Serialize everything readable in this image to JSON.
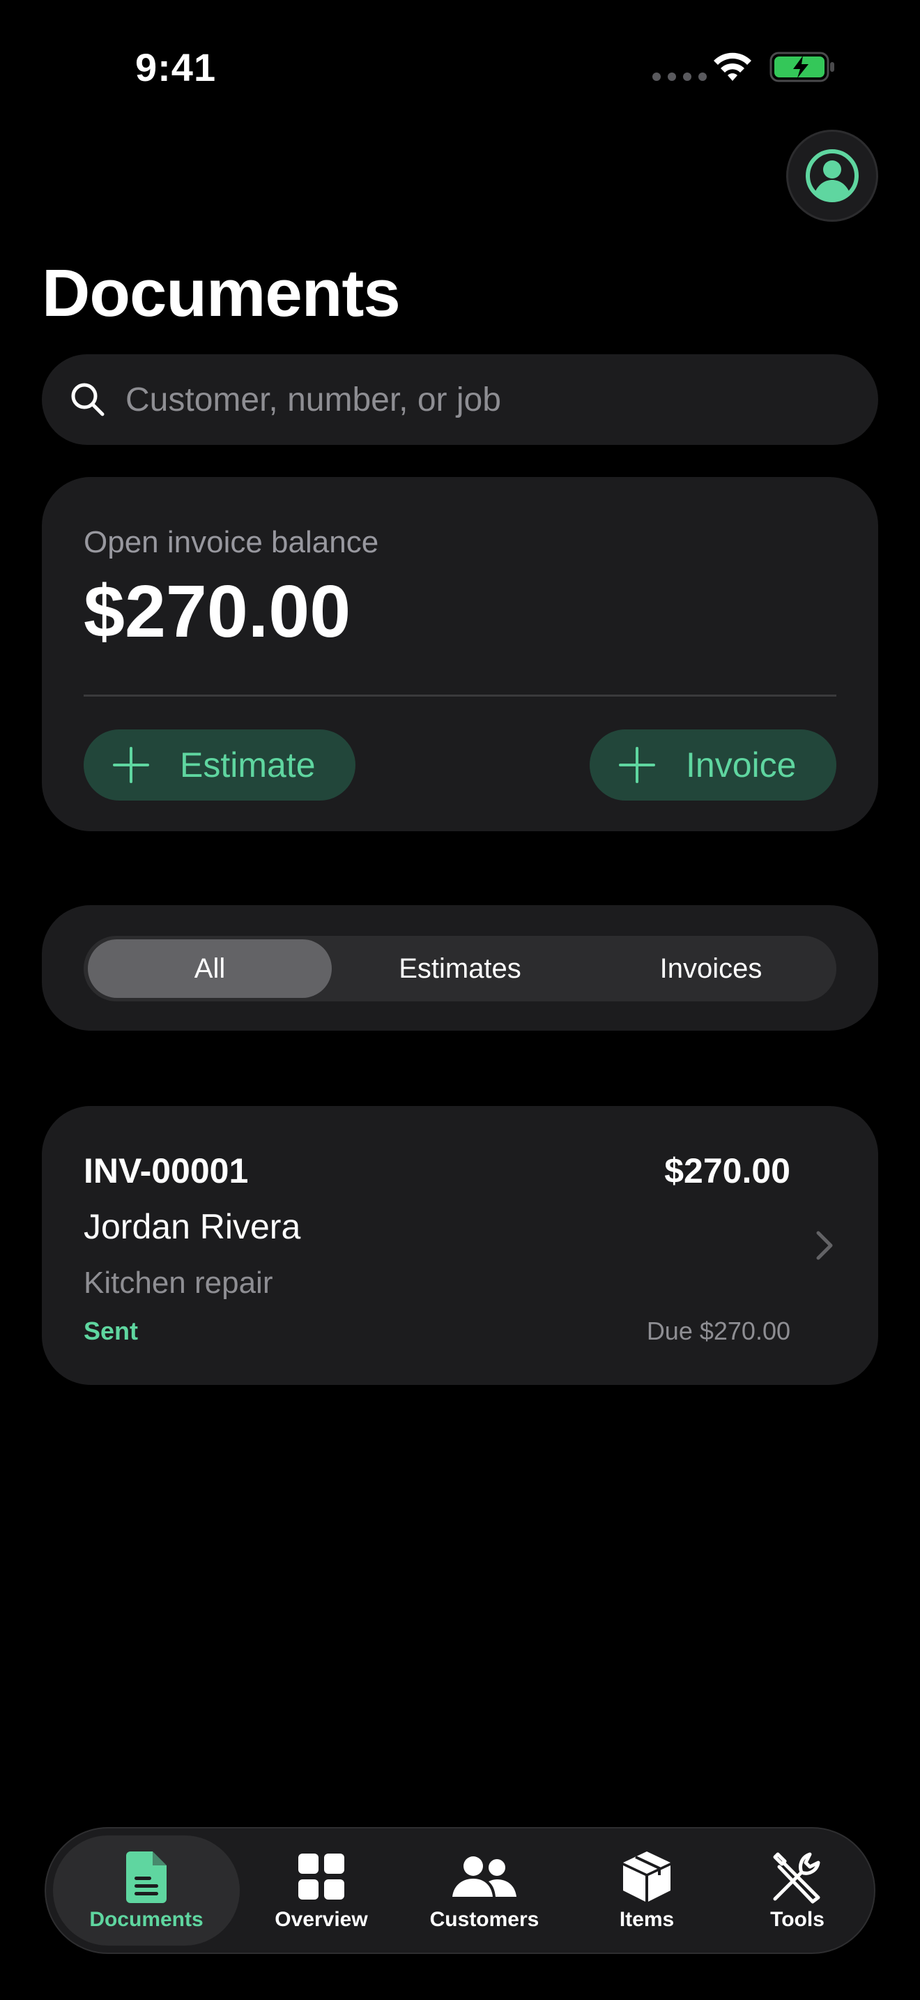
{
  "status_bar": {
    "time": "9:41"
  },
  "header": {
    "title": "Documents"
  },
  "search": {
    "placeholder": "Customer, number, or job",
    "value": ""
  },
  "balance": {
    "label": "Open invoice balance",
    "amount": "$270.00",
    "estimate_button": "Estimate",
    "invoice_button": "Invoice"
  },
  "filter": {
    "segments": [
      "All",
      "Estimates",
      "Invoices"
    ],
    "selected": "All"
  },
  "documents": [
    {
      "number": "INV-00001",
      "amount": "$270.00",
      "customer": "Jordan Rivera",
      "job": "Kitchen repair",
      "status": "Sent",
      "due": "Due $270.00"
    }
  ],
  "tabbar": {
    "items": [
      {
        "label": "Documents",
        "icon": "document-icon",
        "active": true
      },
      {
        "label": "Overview",
        "icon": "grid-icon",
        "active": false
      },
      {
        "label": "Customers",
        "icon": "people-icon",
        "active": false
      },
      {
        "label": "Items",
        "icon": "box-icon",
        "active": false
      },
      {
        "label": "Tools",
        "icon": "tools-icon",
        "active": false
      }
    ]
  },
  "colors": {
    "accent": "#5fd6a0",
    "accent_bg": "#22463a",
    "card": "#1c1c1e",
    "background": "#000000",
    "secondary_text": "#8e8e93"
  }
}
